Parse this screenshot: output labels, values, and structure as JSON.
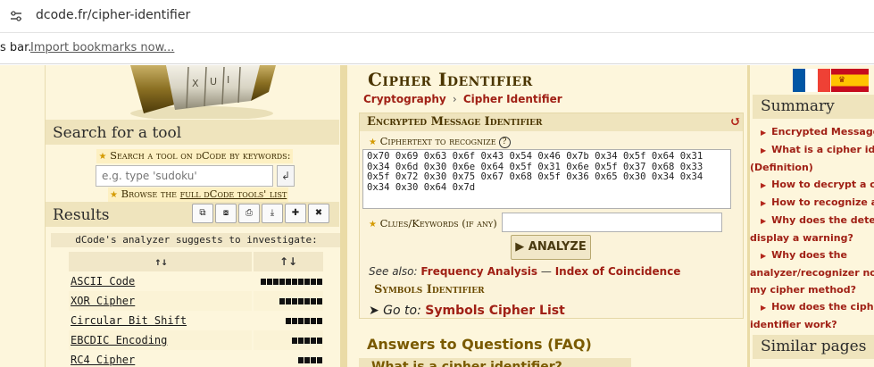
{
  "browser": {
    "url": "dcode.fr/cipher-identifier",
    "bookmarks_prefix": "s bar.",
    "bookmarks_link": "Import bookmarks now..."
  },
  "left": {
    "search_heading": "Search for a tool",
    "search_label": "Search a tool on dCode by keywords:",
    "search_placeholder": "e.g. type 'sudoku'",
    "search_button": "↲",
    "browse_prefix": "Browse the ",
    "browse_link": "full dCode tools' list",
    "results_heading": "Results",
    "tool_buttons": [
      "⧉",
      "⧇",
      "⎙",
      "⤓",
      "✚",
      "✖"
    ],
    "suggest_text": "dCode's analyzer suggests to investigate:",
    "table_headers": [
      "↑↓",
      "↑↓"
    ],
    "results": [
      {
        "name": "ASCII Code",
        "score": 0.95
      },
      {
        "name": "XOR Cipher",
        "score": 0.65
      },
      {
        "name": "Circular Bit Shift",
        "score": 0.56
      },
      {
        "name": "EBCDIC Encoding",
        "score": 0.47
      },
      {
        "name": "RC4 Cipher",
        "score": 0.38
      }
    ]
  },
  "main": {
    "title": "Cipher Identifier",
    "breadcrumb": [
      "Cryptography",
      "Cipher Identifier"
    ],
    "box_title": "Encrypted Message Identifier",
    "reload_icon": "↺",
    "ciphertext_label": "Ciphertext to recognize",
    "help_icon": "?",
    "ciphertext": "0x70 0x69 0x63 0x6f 0x43 0x54 0x46 0x7b 0x34 0x5f 0x64 0x31\n0x34 0x6d 0x30 0x6e 0x64 0x5f 0x31 0x6e 0x5f 0x37 0x68 0x33\n0x5f 0x72 0x30 0x75 0x67 0x68 0x5f 0x36 0x65 0x30 0x34 0x34\n0x34 0x30 0x64 0x7d",
    "clues_label": "Clues/Keywords (if any)",
    "clues_value": "",
    "analyze_button": "▶ ANALYZE",
    "see_also_prefix": "See also:",
    "see_also_links": [
      "Frequency Analysis",
      "Index of Coincidence"
    ],
    "see_also_sep": " — ",
    "symbols_title": "Symbols Identifier",
    "goto_prefix": "➤ Go to:",
    "goto_link": "Symbols Cipher List",
    "faq_title": "Answers to Questions (FAQ)",
    "faq_first": "What is a cipher identifier? (Definition)"
  },
  "right": {
    "summary_heading": "Summary",
    "summary_items": [
      "Encrypted Message Identifier",
      "What is a cipher identifier?",
      "(Definition)",
      "How to decrypt a cipher text?",
      "How to recognize a cipher?",
      "Why does the detector/analyzer",
      "display a warning?",
      "Why does the",
      "analyzer/recognizer not detect",
      "my cipher method?",
      "How does the cipher",
      "identifier work?"
    ],
    "similar_heading": "Similar pages"
  },
  "colors": {
    "page_bg": "#fdf6dc",
    "link_red": "#a02015",
    "title_brown": "#4a3500"
  }
}
